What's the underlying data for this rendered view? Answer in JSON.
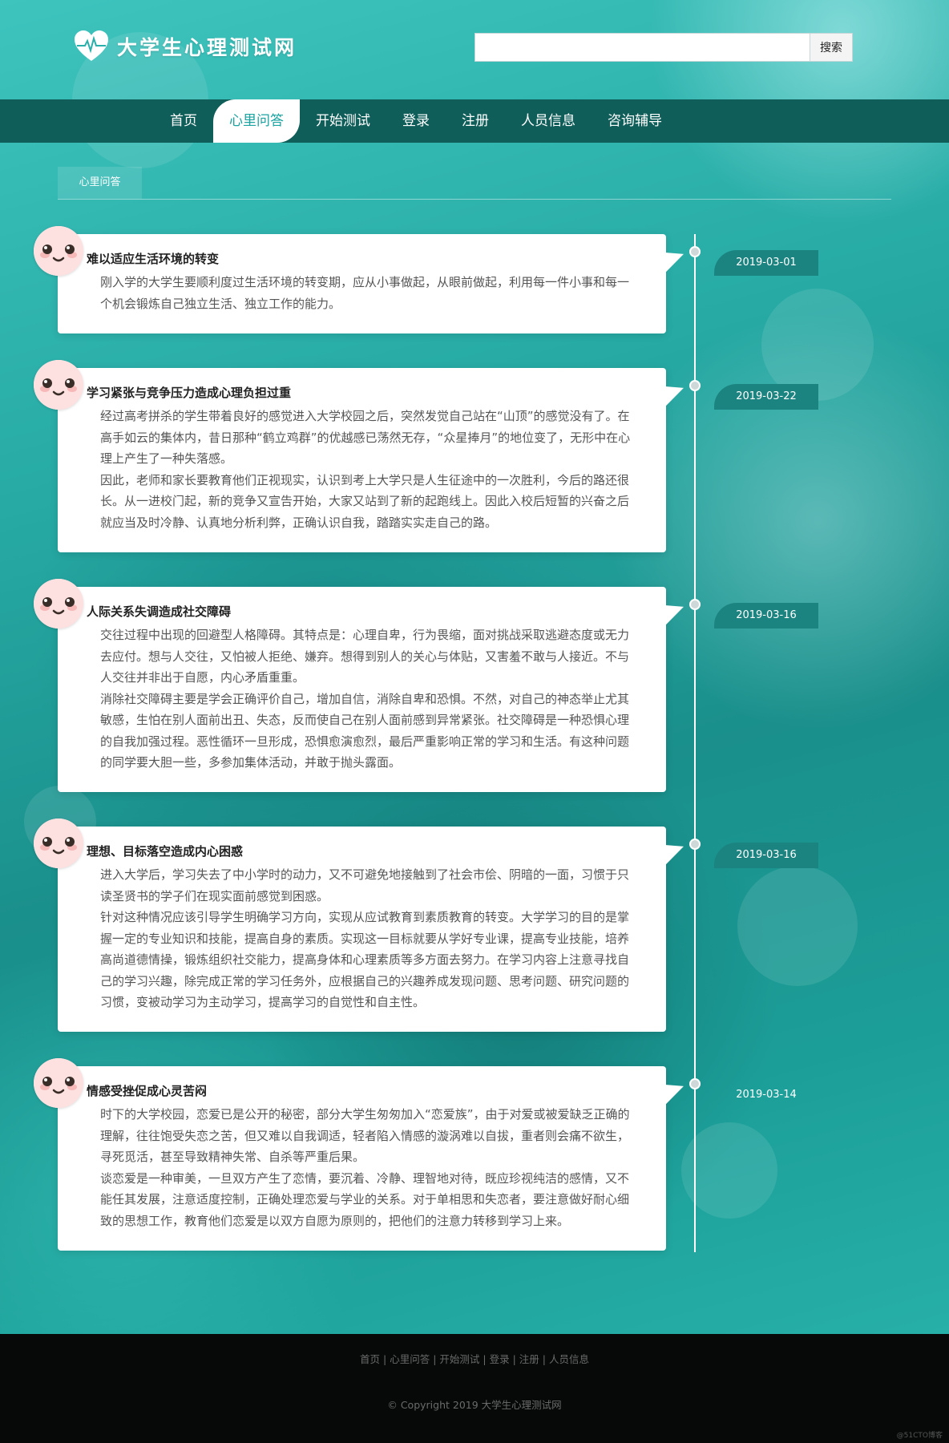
{
  "header": {
    "site_title": "大学生心理测试网",
    "search_placeholder": "",
    "search_button": "搜索"
  },
  "nav": {
    "items": [
      {
        "label": "首页",
        "active": false
      },
      {
        "label": "心里问答",
        "active": true
      },
      {
        "label": "开始测试",
        "active": false
      },
      {
        "label": "登录",
        "active": false
      },
      {
        "label": "注册",
        "active": false
      },
      {
        "label": "人员信息",
        "active": false
      },
      {
        "label": "咨询辅导",
        "active": false
      }
    ]
  },
  "section": {
    "tab_label": "心里问答"
  },
  "posts": [
    {
      "title": "难以适应生活环境的转变",
      "date": "2019-03-01",
      "paragraphs": [
        "刚入学的大学生要顺利度过生活环境的转变期，应从小事做起，从眼前做起，利用每一件小事和每一个机会锻炼自己独立生活、独立工作的能力。"
      ]
    },
    {
      "title": "学习紧张与竞争压力造成心理负担过重",
      "date": "2019-03-22",
      "paragraphs": [
        "经过高考拼杀的学生带着良好的感觉进入大学校园之后，突然发觉自己站在“山顶”的感觉没有了。在高手如云的集体内，昔日那种“鹤立鸡群”的优越感已荡然无存，“众星捧月”的地位变了，无形中在心理上产生了一种失落感。",
        "因此，老师和家长要教育他们正视现实，认识到考上大学只是人生征途中的一次胜利，今后的路还很长。从一进校门起，新的竞争又宣告开始，大家又站到了新的起跑线上。因此入校后短暂的兴奋之后就应当及时冷静、认真地分析利弊，正确认识自我，踏踏实实走自己的路。"
      ]
    },
    {
      "title": "人际关系失调造成社交障碍",
      "date": "2019-03-16",
      "paragraphs": [
        "交往过程中出现的回避型人格障碍。其特点是：心理自卑，行为畏缩，面对挑战采取逃避态度或无力去应付。想与人交往，又怕被人拒绝、嫌弃。想得到别人的关心与体贴，又害羞不敢与人接近。不与人交往并非出于自愿，内心矛盾重重。",
        "消除社交障碍主要是学会正确评价自己，增加自信，消除自卑和恐惧。不然，对自己的神态举止尤其敏感，生怕在别人面前出丑、失态，反而使自己在别人面前感到异常紧张。社交障碍是一种恐惧心理的自我加强过程。恶性循环一旦形成，恐惧愈演愈烈，最后严重影响正常的学习和生活。有这种问题的同学要大胆一些，多参加集体活动，并敢于抛头露面。"
      ]
    },
    {
      "title": "理想、目标落空造成内心困惑",
      "date": "2019-03-16",
      "paragraphs": [
        "进入大学后，学习失去了中小学时的动力，又不可避免地接触到了社会市侩、阴暗的一面，习惯于只读圣贤书的学子们在现实面前感觉到困惑。",
        "针对这种情况应该引导学生明确学习方向，实现从应试教育到素质教育的转变。大学学习的目的是掌握一定的专业知识和技能，提高自身的素质。实现这一目标就要从学好专业课，提高专业技能，培养高尚道德情操，锻炼组织社交能力，提高身体和心理素质等多方面去努力。在学习内容上注意寻找自己的学习兴趣，除完成正常的学习任务外，应根据自己的兴趣养成发现问题、思考问题、研究问题的习惯，变被动学习为主动学习，提高学习的自觉性和自主性。"
      ]
    },
    {
      "title": "情感受挫促成心灵苦闷",
      "date": "2019-03-14",
      "paragraphs": [
        "时下的大学校园，恋爱已是公开的秘密，部分大学生匆匆加入“恋爱族”，由于对爱或被爱缺乏正确的理解，往往饱受失恋之苦，但又难以自我调适，轻者陷入情感的漩涡难以自拔，重者则会痛不欲生，寻死觅活，甚至导致精神失常、自杀等严重后果。",
        "谈恋爱是一种审美，一旦双方产生了恋情，要沉着、冷静、理智地对待，既应珍视纯洁的感情，又不能任其发展，注意适度控制，正确处理恋爱与学业的关系。对于单相思和失恋者，要注意做好耐心细致的思想工作，教育他们恋爱是以双方自愿为原则的，把他们的注意力转移到学习上来。"
      ]
    }
  ],
  "footer": {
    "links": [
      "首页",
      "心里问答",
      "开始测试",
      "登录",
      "注册",
      "人员信息"
    ],
    "copyright": "© Copyright 2019 大学生心理测试网",
    "watermark": "@51CTO博客"
  },
  "colors": {
    "nav_bg": "#0f5e5a",
    "active_text": "#1aa3a0",
    "date_badge": "#1c8480",
    "avatar_face": "#fde1e1",
    "footer_bg": "#070909"
  },
  "icons": {
    "logo": "heart-pulse-icon",
    "avatar": "smiley-face-icon"
  }
}
